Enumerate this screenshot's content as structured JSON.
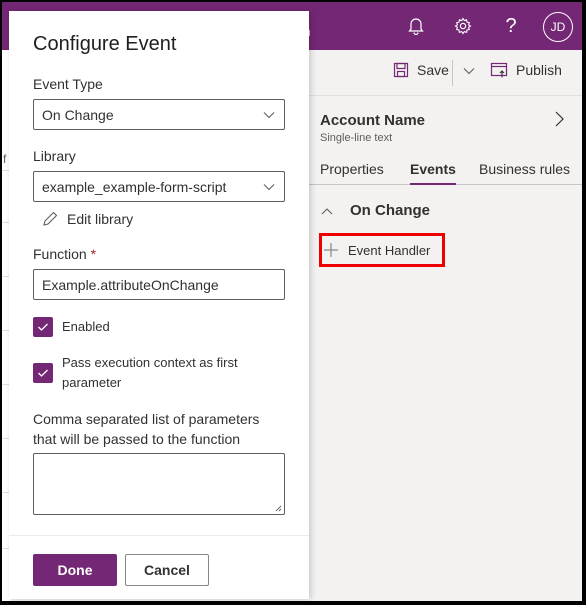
{
  "header": {
    "app_title_fragment": "n",
    "icons": [
      "bell-icon",
      "gear-icon",
      "help-icon"
    ],
    "user_initials": "JD",
    "brand_color": "#742774"
  },
  "commandbar": {
    "save_label": "Save",
    "publish_label": "Publish"
  },
  "pane": {
    "field_title": "Account Name",
    "field_subtitle": "Single-line text",
    "tabs": [
      {
        "label": "Properties",
        "active": false
      },
      {
        "label": "Events",
        "active": true
      },
      {
        "label": "Business rules",
        "active": false
      }
    ],
    "section_label": "On Change",
    "event_handler_label": "Event Handler"
  },
  "dialog": {
    "title": "Configure Event",
    "event_type_label": "Event Type",
    "event_type_value": "On Change",
    "library_label": "Library",
    "library_value": "example_example-form-script",
    "edit_library_label": "Edit library",
    "function_label": "Function",
    "function_required_marker": "*",
    "function_value": "Example.attributeOnChange",
    "enabled_label": "Enabled",
    "enabled_checked": true,
    "pass_context_label": "Pass execution context as first parameter",
    "pass_context_checked": true,
    "params_label": "Comma separated list of parameters that will be passed to the function",
    "params_value": "",
    "done_label": "Done",
    "cancel_label": "Cancel"
  },
  "left_strip": {
    "partial_char": "f"
  }
}
